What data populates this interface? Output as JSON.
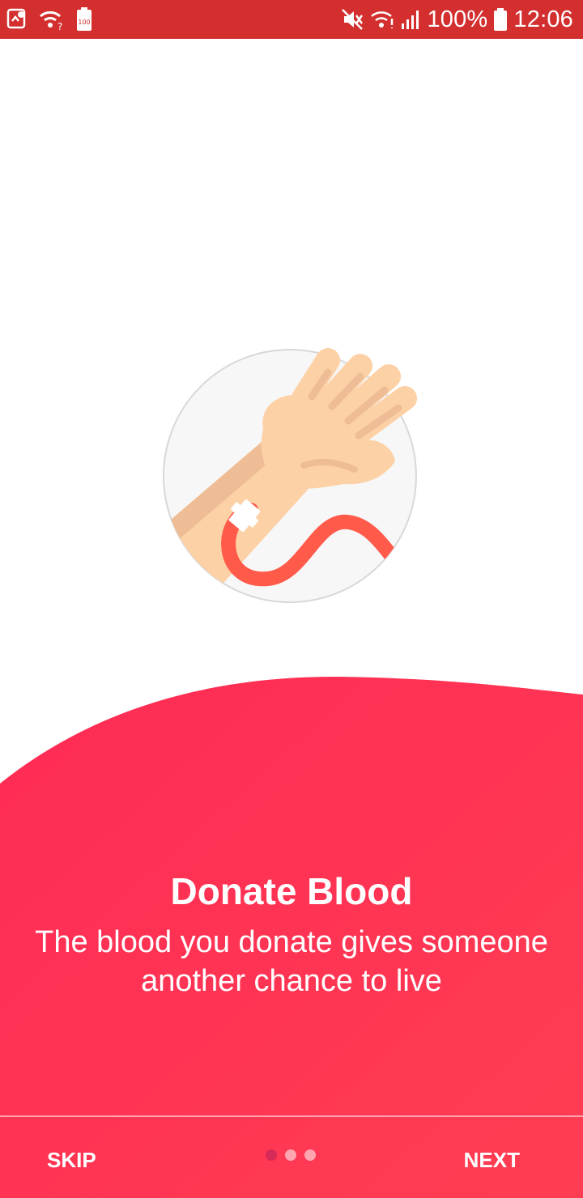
{
  "status_bar": {
    "battery_percent": "100%",
    "time": "12:06",
    "left_icons": [
      "gallery-icon",
      "wifi-question-icon",
      "battery-100-icon"
    ],
    "right_icons": [
      "mute-icon",
      "wifi-icon",
      "signal-icon",
      "battery-icon"
    ],
    "small_battery_label": "100"
  },
  "onboarding": {
    "title": "Donate Blood",
    "subtitle": "The blood you donate gives someone another chance to live",
    "skip_label": "SKIP",
    "next_label": "NEXT",
    "page_indicator": {
      "current": 1,
      "total": 3
    }
  },
  "colors": {
    "status_bar": "#d32f2f",
    "accent": "#ff3355",
    "skin": "#fdd1a6",
    "skin_shade": "#eebd95",
    "tube": "#ff5a4a"
  }
}
